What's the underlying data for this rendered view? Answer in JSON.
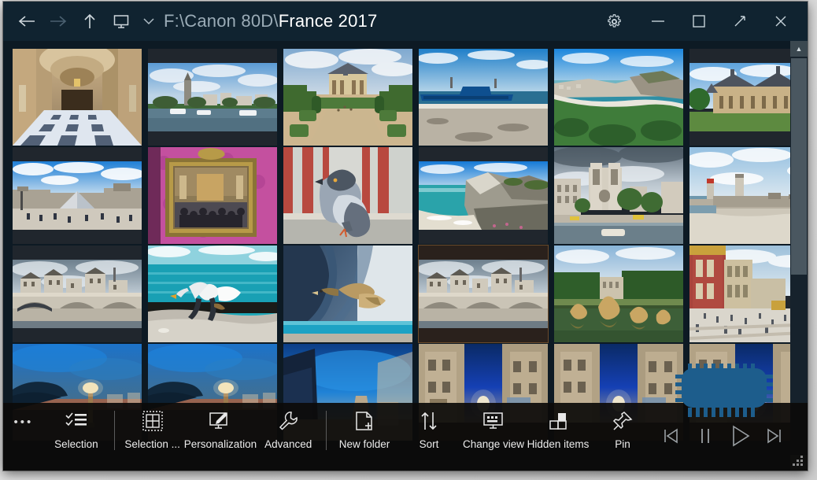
{
  "window": {
    "title_path_prefix": "F:\\Canon 80D\\",
    "title_path_current": "France 2017",
    "nav": {
      "back": "Back",
      "forward": "Forward",
      "up": "Up one level",
      "desktop": "Desktop",
      "dropdown": "Path history"
    },
    "caption": {
      "settings": "Settings",
      "minimize": "Minimize",
      "maximize": "Maximize",
      "restore_diagonal": "Full screen",
      "close": "Close"
    }
  },
  "scrollbar": {
    "up_arrow": "▲",
    "down_arrow": "▼"
  },
  "toolbar": {
    "overflow": "•••",
    "items": [
      {
        "label": "Selection",
        "icon": "checklist-icon"
      },
      {
        "label": "Selection ...",
        "icon": "select-grid-icon"
      },
      {
        "label": "Personalization",
        "icon": "monitor-brush-icon"
      },
      {
        "label": "Advanced",
        "icon": "wrench-icon"
      },
      {
        "label": "New folder",
        "icon": "new-folder-icon"
      },
      {
        "label": "Sort",
        "icon": "sort-arrows-icon"
      },
      {
        "label": "Change view",
        "icon": "change-view-icon"
      },
      {
        "label": "Hidden items",
        "icon": "hidden-items-icon"
      },
      {
        "label": "Pin",
        "icon": "pin-icon"
      }
    ],
    "media": [
      {
        "name": "previous",
        "glyph": "prev-track-icon"
      },
      {
        "name": "pause",
        "glyph": "pause-icon"
      },
      {
        "name": "play",
        "glyph": "play-icon"
      },
      {
        "name": "next",
        "glyph": "next-track-icon"
      }
    ]
  },
  "gallery": {
    "columns": 6,
    "rows": 4,
    "selected_index": 15,
    "items": [
      {
        "caption": "Palace gallery with arches and checkered floor",
        "shape": "tall"
      },
      {
        "caption": "Riverside town with church and boats",
        "shape": "land"
      },
      {
        "caption": "Chateau de Sceaux with gardens",
        "shape": "full"
      },
      {
        "caption": "Blue fishing boat on pebble beach, Etretat",
        "shape": "full"
      },
      {
        "caption": "Etretat coastline and cliffs from above",
        "shape": "full"
      },
      {
        "caption": "Chateau de Mesnieres / Fecamp palace",
        "shape": "land"
      },
      {
        "caption": "Louvre pyramid courtyard",
        "shape": "land"
      },
      {
        "caption": "Gilded painting on pink damask wall",
        "shape": "full"
      },
      {
        "caption": "Pigeon perched on ledge",
        "shape": "full"
      },
      {
        "caption": "Etretat chalk cliffs over turquoise sea",
        "shape": "land"
      },
      {
        "caption": "Notre-Dame de Paris from the Seine",
        "shape": "full"
      },
      {
        "caption": "Harbour lighthouses and jetty",
        "shape": "full"
      },
      {
        "caption": "Pont Neuf over the Seine",
        "shape": "land"
      },
      {
        "caption": "Seagull in flight over the shore",
        "shape": "full"
      },
      {
        "caption": "Bird of prey gliding past a cliff",
        "shape": "full"
      },
      {
        "caption": "Pont Neuf over the Seine (selected)",
        "shape": "land"
      },
      {
        "caption": "Versailles fountain with gilded statues",
        "shape": "full"
      },
      {
        "caption": "Versailles palace courtyard",
        "shape": "full"
      },
      {
        "caption": "Blue hour street with lamp post",
        "shape": "full"
      },
      {
        "caption": "Blue hour street with lamp post",
        "shape": "full"
      },
      {
        "caption": "Night street with blue sky",
        "shape": "full"
      },
      {
        "caption": "Narrow night street with shop signs",
        "shape": "full"
      },
      {
        "caption": "Narrow night street with shop signs",
        "shape": "full"
      },
      {
        "caption": "Narrow night street with shop signs",
        "shape": "full"
      }
    ]
  },
  "colors": {
    "titlebar": "#102330",
    "content_bg": "#0d1a24",
    "toolbar_bg": "#0c0b0a",
    "accent_selected": "#6b4a2a",
    "chip_blue": "#1d5d8c"
  }
}
